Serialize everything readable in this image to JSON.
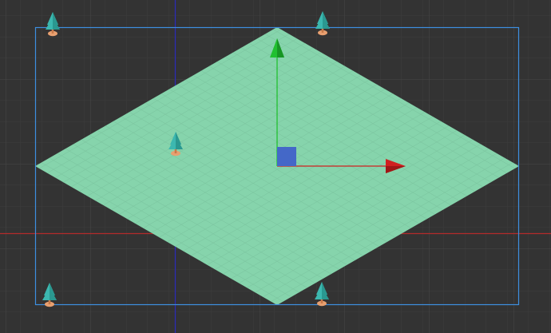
{
  "scene_view": {
    "background_color": "#333333",
    "grid_minor_color": "#3d3d3d",
    "grid_major_color": "#474747",
    "world_x_axis_color": "#b32b2b",
    "world_y_axis_color": "#2b2bb3",
    "camera_bounds_color": "#3d8fe0",
    "tilemap_fill_color": "#86d4ac",
    "tilemap_tile_line_color": "#7bc6a0",
    "gizmo": {
      "x_axis_color": "#d02020",
      "y_axis_color": "#21c030",
      "center_handle_color": "#4468c8"
    },
    "tree_icon": "pine-tree-icon",
    "tree_foliage_color": "#3cb8b0",
    "tree_foliage_dark_color": "#2a9890",
    "tree_base_color": "#e8a070",
    "tree_count": 5
  }
}
